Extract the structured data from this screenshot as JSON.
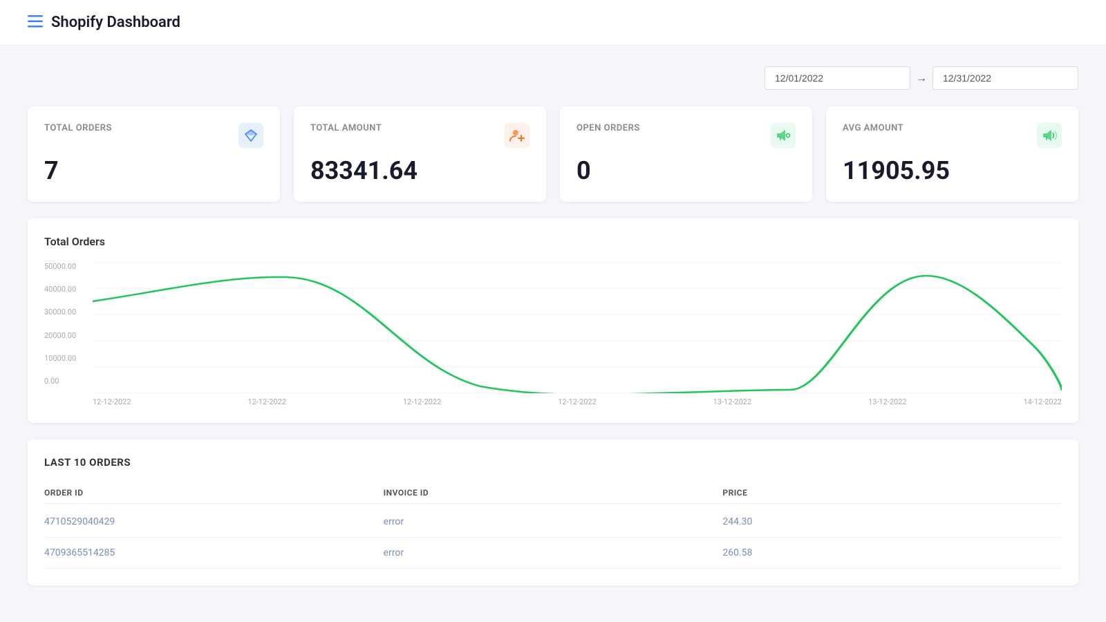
{
  "header": {
    "icon_label": "≡",
    "title": "Shopify Dashboard"
  },
  "date_filter": {
    "start_date": "12/01/2022",
    "end_date": "12/31/2022",
    "arrow": "→"
  },
  "stats": [
    {
      "id": "total-orders",
      "label": "TOTAL ORDERS",
      "value": "7",
      "icon": "💎",
      "icon_style": "blue"
    },
    {
      "id": "total-amount",
      "label": "TOTAL AMOUNT",
      "value": "83341.64",
      "icon": "👤",
      "icon_style": "orange"
    },
    {
      "id": "open-orders",
      "label": "OPEN ORDERS",
      "value": "0",
      "icon": "📢",
      "icon_style": "green-light"
    },
    {
      "id": "avg-amount",
      "label": "AVG AMOUNT",
      "value": "11905.95",
      "icon": "📣",
      "icon_style": "green"
    }
  ],
  "chart": {
    "title": "Total Orders",
    "y_labels": [
      "50000.00",
      "40000.00",
      "30000.00",
      "20000.00",
      "10000.00",
      "0.00"
    ],
    "x_labels": [
      "12-12-2022",
      "12-12-2022",
      "12-12-2022",
      "12-12-2022",
      "13-12-2022",
      "13-12-2022",
      "14-12-2022"
    ]
  },
  "orders_table": {
    "title": "LAST 10 ORDERS",
    "columns": [
      "ORDER ID",
      "INVOICE ID",
      "PRICE"
    ],
    "rows": [
      {
        "order_id": "4710529040429",
        "invoice_id": "error",
        "price": "244.30"
      },
      {
        "order_id": "4709365514285",
        "invoice_id": "error",
        "price": "260.58"
      }
    ]
  },
  "icons": {
    "menu": "☰",
    "diamond": "◆",
    "user_add": "👤+",
    "megaphone": "📢",
    "speaker": "📣"
  }
}
